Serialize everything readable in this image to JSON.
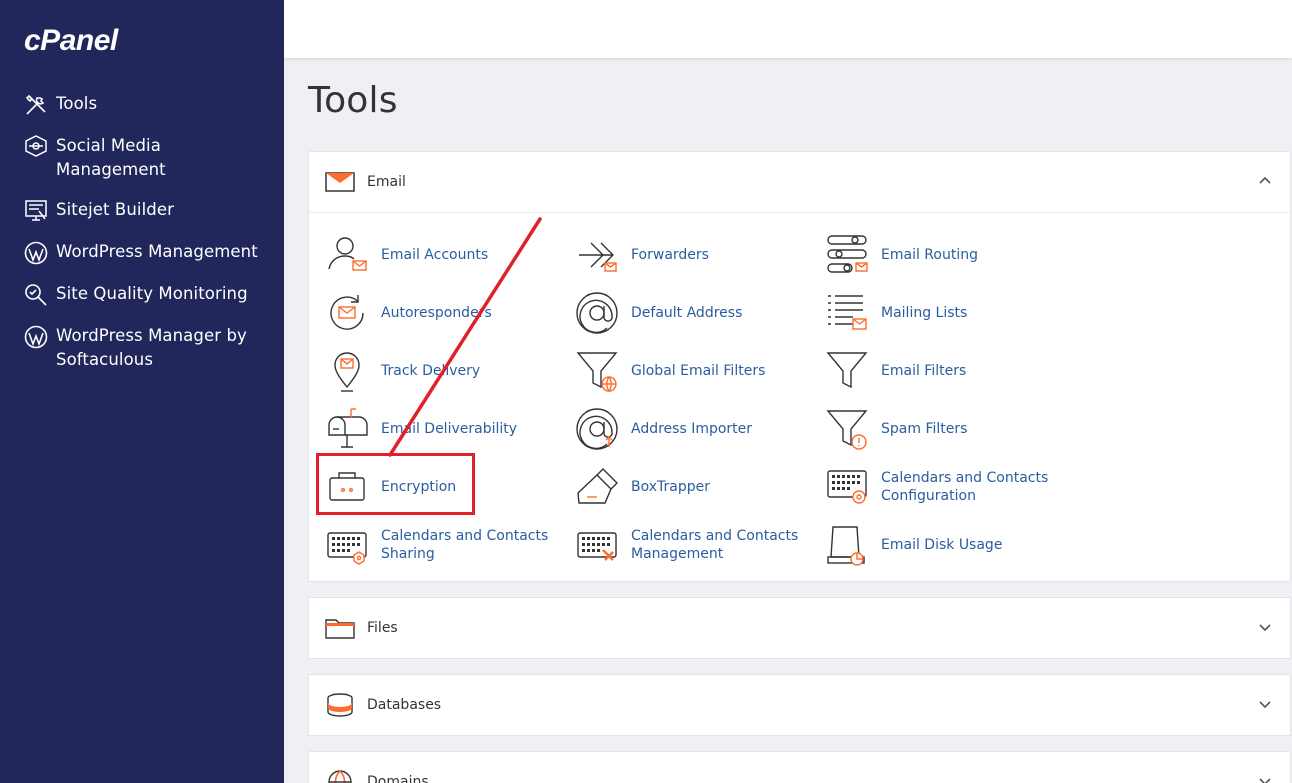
{
  "brand": {
    "logo": "cPanel"
  },
  "sidebar": {
    "items": [
      {
        "label": "Tools",
        "icon": "tools-icon"
      },
      {
        "label": "Social Media Management",
        "icon": "social-media-icon"
      },
      {
        "label": "Sitejet Builder",
        "icon": "sitejet-icon"
      },
      {
        "label": "WordPress Management",
        "icon": "wordpress-icon"
      },
      {
        "label": "Site Quality Monitoring",
        "icon": "site-quality-icon"
      },
      {
        "label": "WordPress Manager by Softaculous",
        "icon": "wordpress-icon"
      }
    ]
  },
  "page": {
    "title": "Tools"
  },
  "panels": {
    "email": {
      "title": "Email",
      "icon": "envelope-icon",
      "expanded": true
    },
    "files": {
      "title": "Files",
      "icon": "folder-icon",
      "expanded": false
    },
    "databases": {
      "title": "Databases",
      "icon": "database-icon",
      "expanded": false
    },
    "domains": {
      "title": "Domains",
      "icon": "globe-icon",
      "expanded": false
    }
  },
  "email_tools": {
    "email_accounts": "Email Accounts",
    "forwarders": "Forwarders",
    "email_routing": "Email Routing",
    "autoresponders": "Autoresponders",
    "default_address": "Default Address",
    "mailing_lists": "Mailing Lists",
    "track_delivery": "Track Delivery",
    "global_email_filters": "Global Email Filters",
    "email_filters": "Email Filters",
    "email_deliverability": "Email Deliverability",
    "address_importer": "Address Importer",
    "spam_filters": "Spam Filters",
    "encryption": "Encryption",
    "boxtrapper": "BoxTrapper",
    "calendars_contacts_configuration_1": "Calendars and Contacts",
    "calendars_contacts_configuration_2": "Configuration",
    "calendars_contacts_sharing_1": "Calendars and Contacts",
    "calendars_contacts_sharing_2": "Sharing",
    "calendars_contacts_management_1": "Calendars and Contacts",
    "calendars_contacts_management_2": "Management",
    "email_disk_usage": "Email Disk Usage"
  },
  "colors": {
    "sidebar_bg": "#21275a",
    "accent": "#ff6c2c",
    "link": "#2a5d9f",
    "highlight": "#e0202a"
  }
}
